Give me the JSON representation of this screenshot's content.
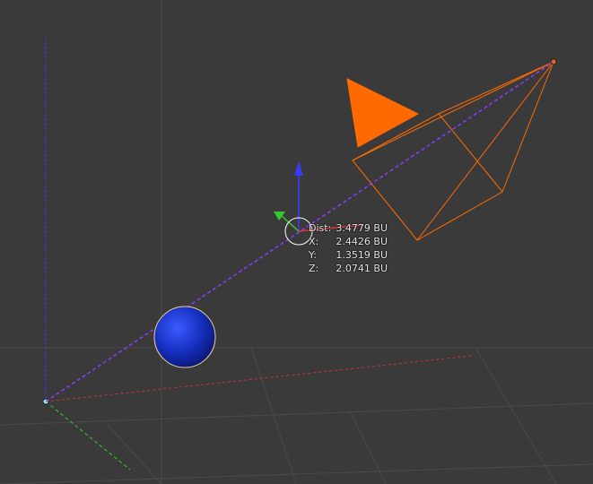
{
  "viewport": {
    "background_color": "#3a3a3a",
    "grid_color": "#4a4a4a",
    "axis_colors": {
      "x": "#c83232",
      "y": "#32c832",
      "z": "#3a3aff"
    }
  },
  "scene_objects": {
    "camera_color": "#ff6a00",
    "sphere_color": "#1230c8",
    "sphere_outline_color": "#f0d090",
    "measure_line_color": "#8a3cff"
  },
  "measurement": {
    "dist_label": "Dist:",
    "dist_value": "3.4779 BU",
    "x_label": "X:",
    "x_value": "2.4426 BU",
    "y_label": "Y:",
    "y_value": "1.3519 BU",
    "z_label": "Z:",
    "z_value": "2.0741 BU"
  },
  "gizmo_icons": {
    "z_arrow": "z-axis-arrow-icon",
    "y_arrow": "y-axis-arrow-icon",
    "center": "transform-center-icon"
  }
}
